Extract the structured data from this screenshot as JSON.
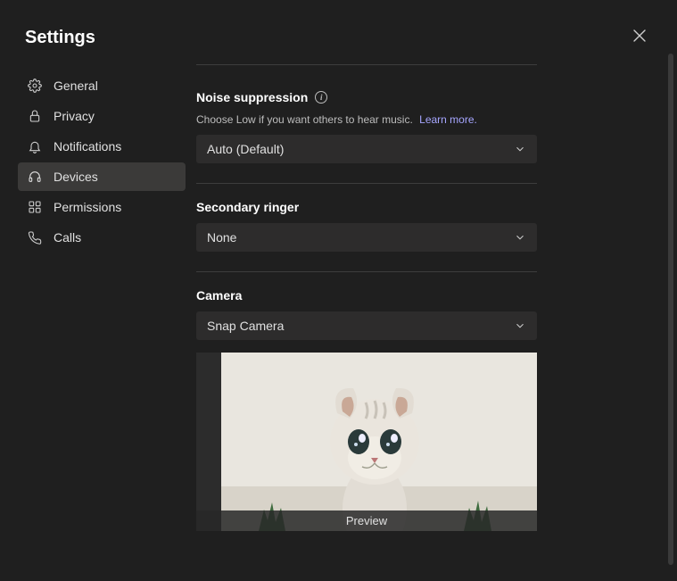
{
  "header": {
    "title": "Settings"
  },
  "sidebar": {
    "items": [
      {
        "label": "General"
      },
      {
        "label": "Privacy"
      },
      {
        "label": "Notifications"
      },
      {
        "label": "Devices"
      },
      {
        "label": "Permissions"
      },
      {
        "label": "Calls"
      }
    ]
  },
  "noise_suppression": {
    "heading": "Noise suppression",
    "help_text": "Choose Low if you want others to hear music.",
    "learn_more": "Learn more.",
    "value": "Auto (Default)"
  },
  "secondary_ringer": {
    "heading": "Secondary ringer",
    "value": "None"
  },
  "camera": {
    "heading": "Camera",
    "value": "Snap Camera",
    "preview_label": "Preview"
  }
}
